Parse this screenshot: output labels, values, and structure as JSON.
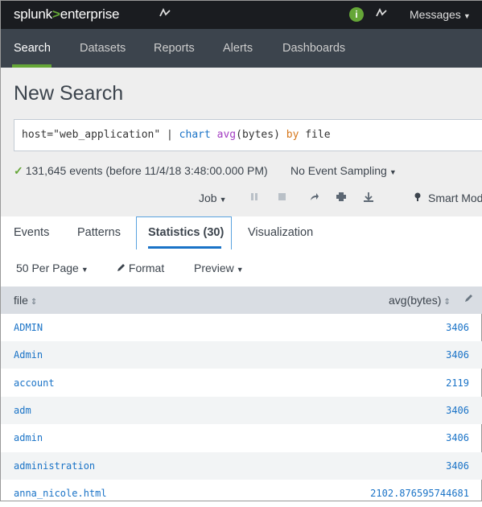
{
  "topbar": {
    "brand_splunk": "splunk",
    "brand_gt": ">",
    "brand_enterprise": "enterprise",
    "messages_label": "Messages",
    "info_glyph": "i"
  },
  "nav": {
    "items": [
      "Search",
      "Datasets",
      "Reports",
      "Alerts",
      "Dashboards"
    ],
    "active": "Search"
  },
  "page": {
    "title": "New Search"
  },
  "search": {
    "q1": "host=\"web_application\" | ",
    "q_cmd": "chart",
    "q_sp": " ",
    "q_fn": "avg",
    "q2": "(bytes) ",
    "q_kw": "by",
    "q3": " file"
  },
  "status": {
    "events": "131,645 events (before 11/4/18 3:48:00.000 PM)",
    "sampling": "No Event Sampling"
  },
  "jobbar": {
    "job_label": "Job",
    "smart_mode": "Smart Mode"
  },
  "tabs": {
    "events": "Events",
    "patterns": "Patterns",
    "statistics": "Statistics (30)",
    "visualization": "Visualization"
  },
  "toolbar": {
    "per_page": "50 Per Page",
    "format": "Format",
    "preview": "Preview"
  },
  "table": {
    "columns": [
      "file",
      "avg(bytes)"
    ],
    "rows": [
      {
        "file": "ADMIN",
        "avg": "3406"
      },
      {
        "file": "Admin",
        "avg": "3406"
      },
      {
        "file": "account",
        "avg": "2119"
      },
      {
        "file": "adm",
        "avg": "3406"
      },
      {
        "file": "admin",
        "avg": "3406"
      },
      {
        "file": "administration",
        "avg": "3406"
      },
      {
        "file": "anna_nicole.html",
        "avg": "2102.876595744681"
      }
    ]
  },
  "colors": {
    "accent_green": "#65a637",
    "link_blue": "#1a73c7",
    "nav_bg": "#3c444d",
    "top_bg": "#1a1c20"
  },
  "icons": [
    "activity-icon",
    "info-icon",
    "pause-icon",
    "stop-icon",
    "share-icon",
    "print-icon",
    "export-icon",
    "bulb-icon",
    "pencil-icon",
    "sort-icon",
    "check-icon"
  ]
}
